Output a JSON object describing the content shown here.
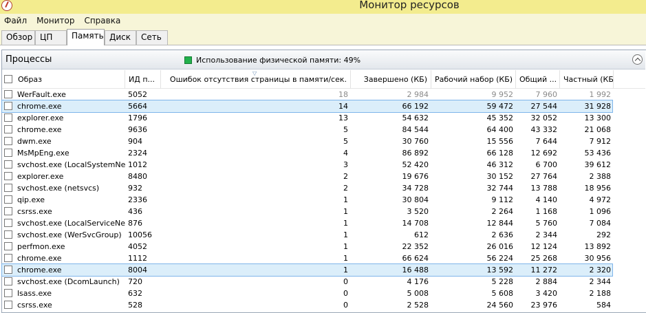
{
  "window": {
    "title": "Монитор ресурсов"
  },
  "menu": [
    "Файл",
    "Монитор",
    "Справка"
  ],
  "tabs": [
    "Обзор",
    "ЦП",
    "Память",
    "Диск",
    "Сеть"
  ],
  "active_tab": "Память",
  "processes_panel": {
    "title": "Процессы",
    "usage_text": "Использование физической памяти: 49%",
    "columns": {
      "image": "Образ",
      "pid": "ИД п...",
      "faults": "Ошибок отсутствия страницы в памяти/сек.",
      "commit": "Завершено (КБ)",
      "working_set": "Рабочий набор (КБ)",
      "shareable": "Общий ...",
      "private": "Частный (КБ)"
    },
    "rows": [
      {
        "image": "WerFault.exe",
        "pid": "5052",
        "faults": "18",
        "commit": "2 984",
        "working_set": "9 952",
        "shareable": "7 960",
        "private": "1 992"
      },
      {
        "image": "chrome.exe",
        "pid": "5664",
        "faults": "14",
        "commit": "66 192",
        "working_set": "59 472",
        "shareable": "27 544",
        "private": "31 928"
      },
      {
        "image": "explorer.exe",
        "pid": "1796",
        "faults": "13",
        "commit": "54 632",
        "working_set": "45 352",
        "shareable": "32 052",
        "private": "13 300"
      },
      {
        "image": "chrome.exe",
        "pid": "9636",
        "faults": "5",
        "commit": "84 544",
        "working_set": "64 400",
        "shareable": "43 332",
        "private": "21 068"
      },
      {
        "image": "dwm.exe",
        "pid": "904",
        "faults": "5",
        "commit": "30 760",
        "working_set": "15 556",
        "shareable": "7 644",
        "private": "7 912"
      },
      {
        "image": "MsMpEng.exe",
        "pid": "2324",
        "faults": "4",
        "commit": "86 892",
        "working_set": "66 128",
        "shareable": "12 692",
        "private": "53 436"
      },
      {
        "image": "svchost.exe (LocalSystemNet...",
        "pid": "1012",
        "faults": "3",
        "commit": "52 420",
        "working_set": "46 312",
        "shareable": "6 700",
        "private": "39 612"
      },
      {
        "image": "explorer.exe",
        "pid": "8480",
        "faults": "2",
        "commit": "19 676",
        "working_set": "30 152",
        "shareable": "27 764",
        "private": "2 388"
      },
      {
        "image": "svchost.exe (netsvcs)",
        "pid": "932",
        "faults": "2",
        "commit": "34 728",
        "working_set": "32 744",
        "shareable": "13 788",
        "private": "18 956"
      },
      {
        "image": "qip.exe",
        "pid": "2336",
        "faults": "1",
        "commit": "30 804",
        "working_set": "9 112",
        "shareable": "4 140",
        "private": "4 972"
      },
      {
        "image": "csrss.exe",
        "pid": "436",
        "faults": "1",
        "commit": "3 520",
        "working_set": "2 264",
        "shareable": "1 168",
        "private": "1 096"
      },
      {
        "image": "svchost.exe (LocalServiceNet...",
        "pid": "876",
        "faults": "1",
        "commit": "14 708",
        "working_set": "12 844",
        "shareable": "5 760",
        "private": "7 084"
      },
      {
        "image": "svchost.exe (WerSvcGroup)",
        "pid": "10056",
        "faults": "1",
        "commit": "612",
        "working_set": "2 636",
        "shareable": "2 344",
        "private": "292"
      },
      {
        "image": "perfmon.exe",
        "pid": "4052",
        "faults": "1",
        "commit": "22 352",
        "working_set": "26 016",
        "shareable": "12 124",
        "private": "13 892"
      },
      {
        "image": "chrome.exe",
        "pid": "1112",
        "faults": "1",
        "commit": "66 624",
        "working_set": "56 224",
        "shareable": "25 268",
        "private": "30 956"
      },
      {
        "image": "chrome.exe",
        "pid": "8004",
        "faults": "1",
        "commit": "16 488",
        "working_set": "13 592",
        "shareable": "11 272",
        "private": "2 320"
      },
      {
        "image": "svchost.exe (DcomLaunch)",
        "pid": "720",
        "faults": "0",
        "commit": "4 176",
        "working_set": "5 228",
        "shareable": "2 884",
        "private": "2 344"
      },
      {
        "image": "lsass.exe",
        "pid": "632",
        "faults": "0",
        "commit": "5 008",
        "working_set": "5 608",
        "shareable": "3 420",
        "private": "2 188"
      },
      {
        "image": "csrss.exe",
        "pid": "528",
        "faults": "0",
        "commit": "2 528",
        "working_set": "24 560",
        "shareable": "23 976",
        "private": "584"
      }
    ],
    "selected_rows": [
      1,
      15
    ],
    "dimmed_rows": [
      0
    ],
    "colors": {
      "indicator": "#22b14c",
      "title_bar": "#f3ec8e",
      "selection": "#dbeefa"
    }
  }
}
